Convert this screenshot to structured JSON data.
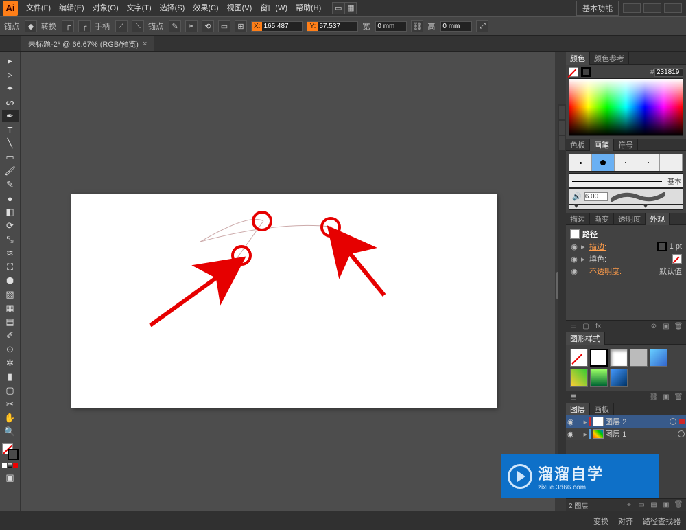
{
  "menubar": {
    "logo": "Ai",
    "items": [
      "文件(F)",
      "编辑(E)",
      "对象(O)",
      "文字(T)",
      "选择(S)",
      "效果(C)",
      "视图(V)",
      "窗口(W)",
      "帮助(H)"
    ],
    "workspace": "基本功能"
  },
  "controlbar": {
    "anchor_label": "锚点",
    "convert_label": "转换",
    "handle_label": "手柄",
    "anchors_label": "锚点",
    "x_label": "X:",
    "y_label": "Y:",
    "w_label": "宽",
    "h_label": "高",
    "x_value": "165.487",
    "y_value": "57.537",
    "w_value": "0 mm",
    "h_value": "0 mm"
  },
  "document": {
    "tab_title": "未标题-2* @ 66.67% (RGB/预览)",
    "zoom": "66.67%",
    "page": "1",
    "tool_name": "钢笔"
  },
  "panels": {
    "color": {
      "tab": "颜色",
      "tab2": "颜色参考",
      "hex": "231819"
    },
    "swatches": {
      "tabs": [
        "色板",
        "画笔",
        "符号"
      ],
      "basic_label": "基本",
      "size": "6.00"
    },
    "stroke": {
      "tabs": [
        "描边",
        "渐变",
        "透明度",
        "外观"
      ],
      "object_label": "路径",
      "stroke_label": "描边:",
      "stroke_value": "1 pt",
      "fill_label": "填色:",
      "opacity_label": "不透明度:",
      "opacity_value": "默认值"
    },
    "styles": {
      "tab": "图形样式"
    },
    "layers": {
      "tabs": [
        "图层",
        "画板"
      ],
      "rows": [
        {
          "name": "图层 2",
          "color": "#d02828"
        },
        {
          "name": "图层 1",
          "color": "#5aa0e0"
        }
      ],
      "count_label": "2 图层"
    }
  },
  "status": {
    "items": [
      "变换",
      "对齐",
      "路径查找器"
    ]
  },
  "watermark": {
    "title": "溜溜自学",
    "url": "zixue.3d66.com"
  }
}
